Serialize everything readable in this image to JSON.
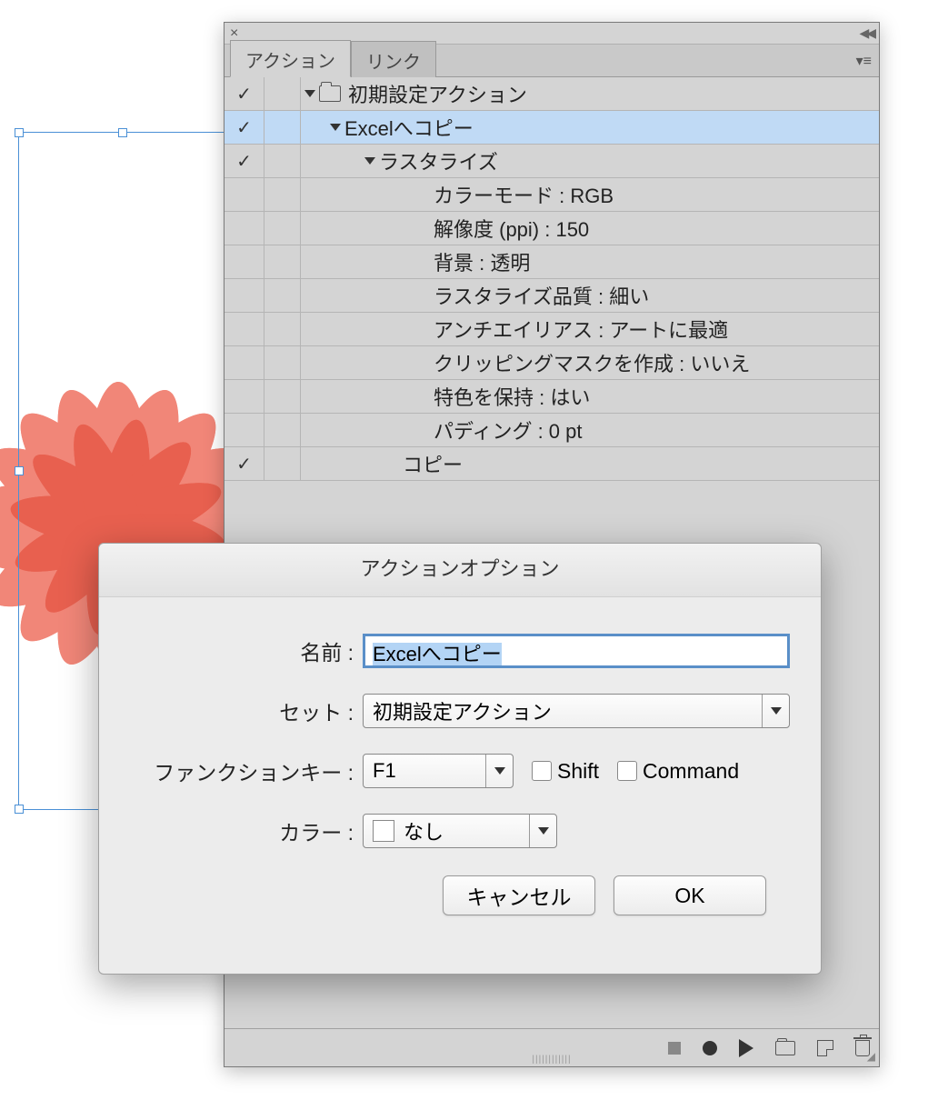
{
  "panel": {
    "tabs": {
      "actions": "アクション",
      "links": "リンク"
    }
  },
  "actions": {
    "root": "初期設定アクション",
    "action1": "Excelへコピー",
    "step_rasterize": "ラスタライズ",
    "params": {
      "color_mode": "カラーモード : RGB",
      "resolution": "解像度 (ppi) : 150",
      "background": "背景 : 透明",
      "quality": "ラスタライズ品質 : 細い",
      "antialias": "アンチエイリアス : アートに最適",
      "clipping": "クリッピングマスクを作成 : いいえ",
      "spot": "特色を保持 : はい",
      "padding": "パディング : 0 pt"
    },
    "step_copy": "コピー"
  },
  "dialog": {
    "title": "アクションオプション",
    "labels": {
      "name": "名前 :",
      "set": "セット :",
      "fkey": "ファンクションキー :",
      "color": "カラー :"
    },
    "name_value": "Excelへコピー",
    "set_value": "初期設定アクション",
    "fkey_value": "F1",
    "shift_label": "Shift",
    "command_label": "Command",
    "color_value": "なし",
    "cancel": "キャンセル",
    "ok": "OK"
  }
}
